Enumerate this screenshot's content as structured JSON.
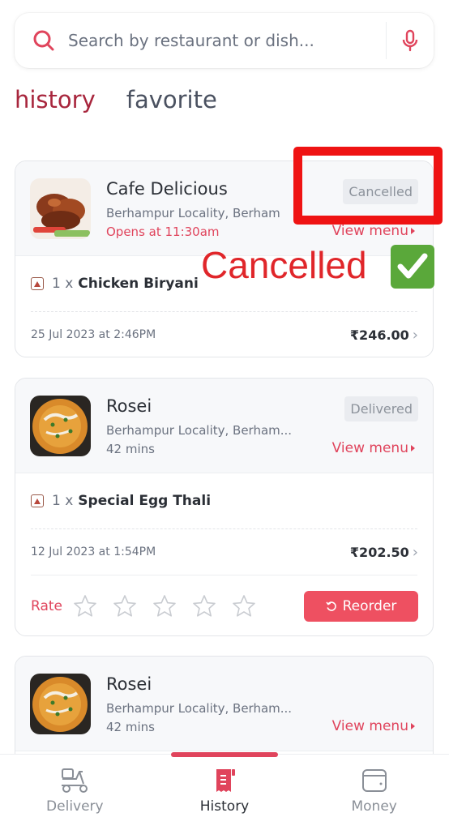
{
  "search": {
    "placeholder": "Search by restaurant or dish...",
    "icon": "search-icon",
    "mic_icon": "microphone-icon"
  },
  "tabs": [
    {
      "label": "history",
      "active": true
    },
    {
      "label": "favorite",
      "active": false
    }
  ],
  "orders": [
    {
      "restaurant": "Cafe Delicious",
      "address": "Berhampur Locality, Berham",
      "meta": "Opens at 11:30am",
      "status": "Cancelled",
      "view_menu": "View menu",
      "items": [
        {
          "qty": "1 x",
          "name": "Chicken Biryani"
        }
      ],
      "date": "25 Jul 2023 at 2:46PM",
      "price": "₹246.00"
    },
    {
      "restaurant": "Rosei",
      "address": "Berhampur Locality, Berham...",
      "meta": "42 mins",
      "status": "Delivered",
      "view_menu": "View menu",
      "items": [
        {
          "qty": "1 x",
          "name": "Special Egg Thali"
        }
      ],
      "date": "12 Jul 2023 at 1:54PM",
      "price": "₹202.50",
      "rate_label": "Rate",
      "rating": 0,
      "rating_max": 5,
      "reorder_label": "Reorder"
    },
    {
      "restaurant": "Rosei",
      "address": "Berhampur Locality, Berham...",
      "meta": "42 mins",
      "view_menu": "View menu"
    }
  ],
  "annotation": {
    "text": "Cancelled",
    "check": "✔"
  },
  "bottom_nav": [
    {
      "label": "Delivery",
      "icon": "scooter-icon",
      "active": false
    },
    {
      "label": "History",
      "icon": "receipt-icon",
      "active": true
    },
    {
      "label": "Money",
      "icon": "wallet-icon",
      "active": false
    }
  ],
  "colors": {
    "accent": "#e0445c",
    "tab_active": "#a8263d",
    "reorder_bg": "#ee5061",
    "annotation_red": "#ef1313",
    "annotation_check_bg": "#5aa83a"
  }
}
